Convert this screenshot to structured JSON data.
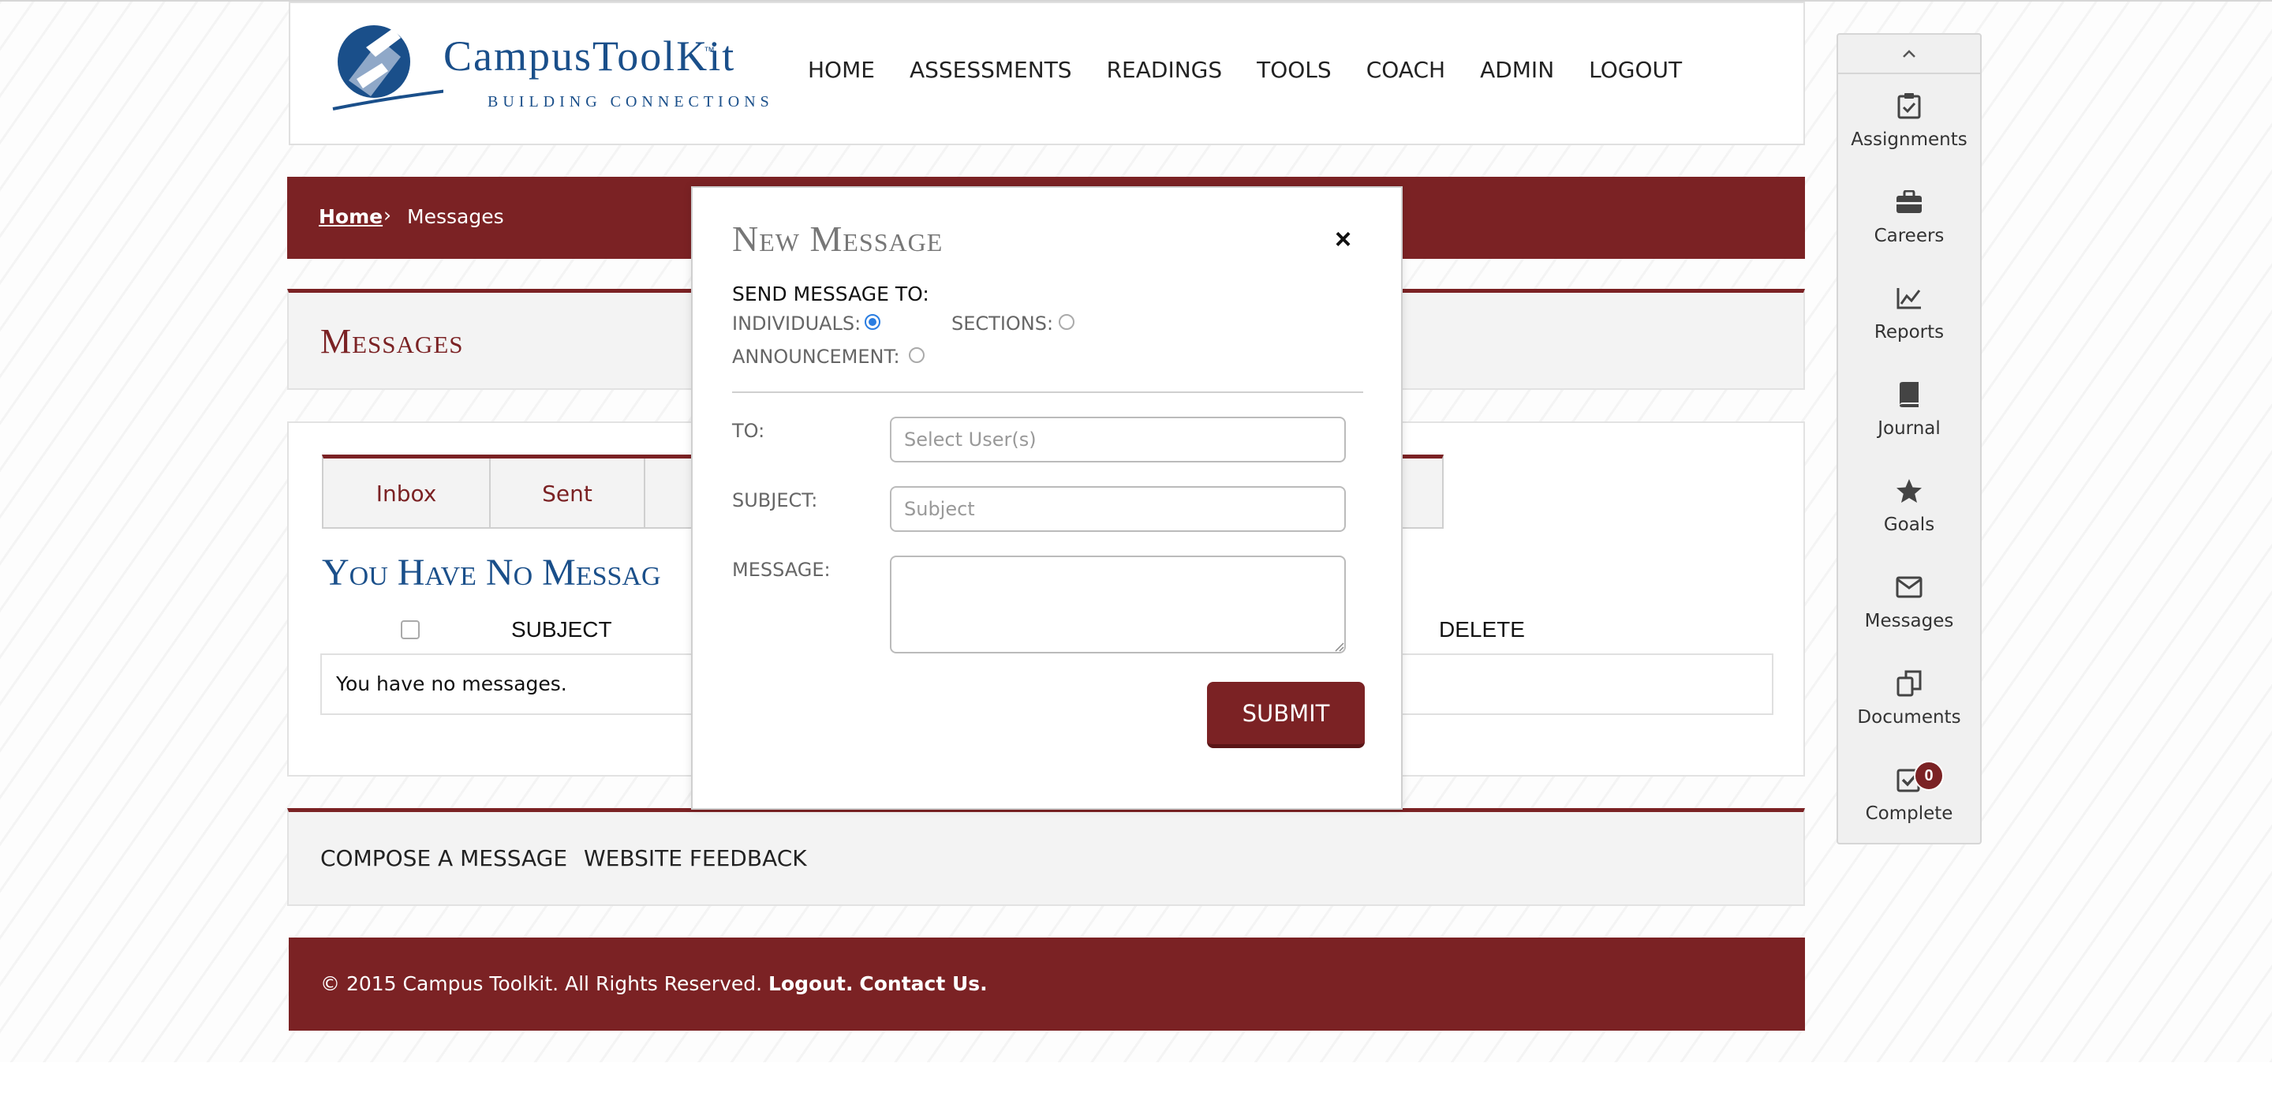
{
  "brand": {
    "name": "CampusToolKit",
    "trademark": "™",
    "tagline": "BUILDING CONNECTIONS",
    "primary_color": "#7b2224",
    "logo_blue": "#1a4f8a"
  },
  "nav": {
    "items": [
      "HOME",
      "ASSESSMENTS",
      "READINGS",
      "TOOLS",
      "COACH",
      "ADMIN",
      "LOGOUT"
    ]
  },
  "breadcrumb": {
    "home": "Home",
    "separator": "›",
    "current": "Messages"
  },
  "page": {
    "title": "Messages"
  },
  "messages": {
    "tabs": [
      "Inbox",
      "Sent"
    ],
    "empty_title": "You Have No Messag",
    "columns": {
      "subject": "SUBJECT",
      "delete": "DELETE"
    },
    "empty_text": "You have no messages."
  },
  "footer_links": {
    "compose": "COMPOSE A MESSAGE",
    "feedback": "WEBSITE FEEDBACK"
  },
  "copyright": {
    "text": "© 2015 Campus Toolkit. All Rights Reserved.",
    "logout": "Logout.",
    "contact": "Contact Us."
  },
  "sidebar": {
    "collapse_icon": "chevron-up-icon",
    "items": [
      {
        "label": "Assignments",
        "icon": "clipboard-check-icon"
      },
      {
        "label": "Careers",
        "icon": "briefcase-icon"
      },
      {
        "label": "Reports",
        "icon": "line-chart-icon"
      },
      {
        "label": "Journal",
        "icon": "book-icon"
      },
      {
        "label": "Goals",
        "icon": "star-icon"
      },
      {
        "label": "Messages",
        "icon": "envelope-icon"
      },
      {
        "label": "Documents",
        "icon": "documents-icon"
      },
      {
        "label": "Complete",
        "icon": "check-square-icon",
        "badge": "0"
      }
    ]
  },
  "modal": {
    "title": "New Message",
    "close": "×",
    "send_to_label": "SEND MESSAGE TO:",
    "options": {
      "individuals": "INDIVIDUALS:",
      "sections": "SECTIONS:",
      "announcement": "ANNOUNCEMENT:"
    },
    "selected_option": "individuals",
    "to_label": "TO:",
    "to_placeholder": "Select User(s)",
    "subject_label": "SUBJECT:",
    "subject_placeholder": "Subject",
    "message_label": "MESSAGE:",
    "message_value": "",
    "submit": "SUBMIT"
  }
}
